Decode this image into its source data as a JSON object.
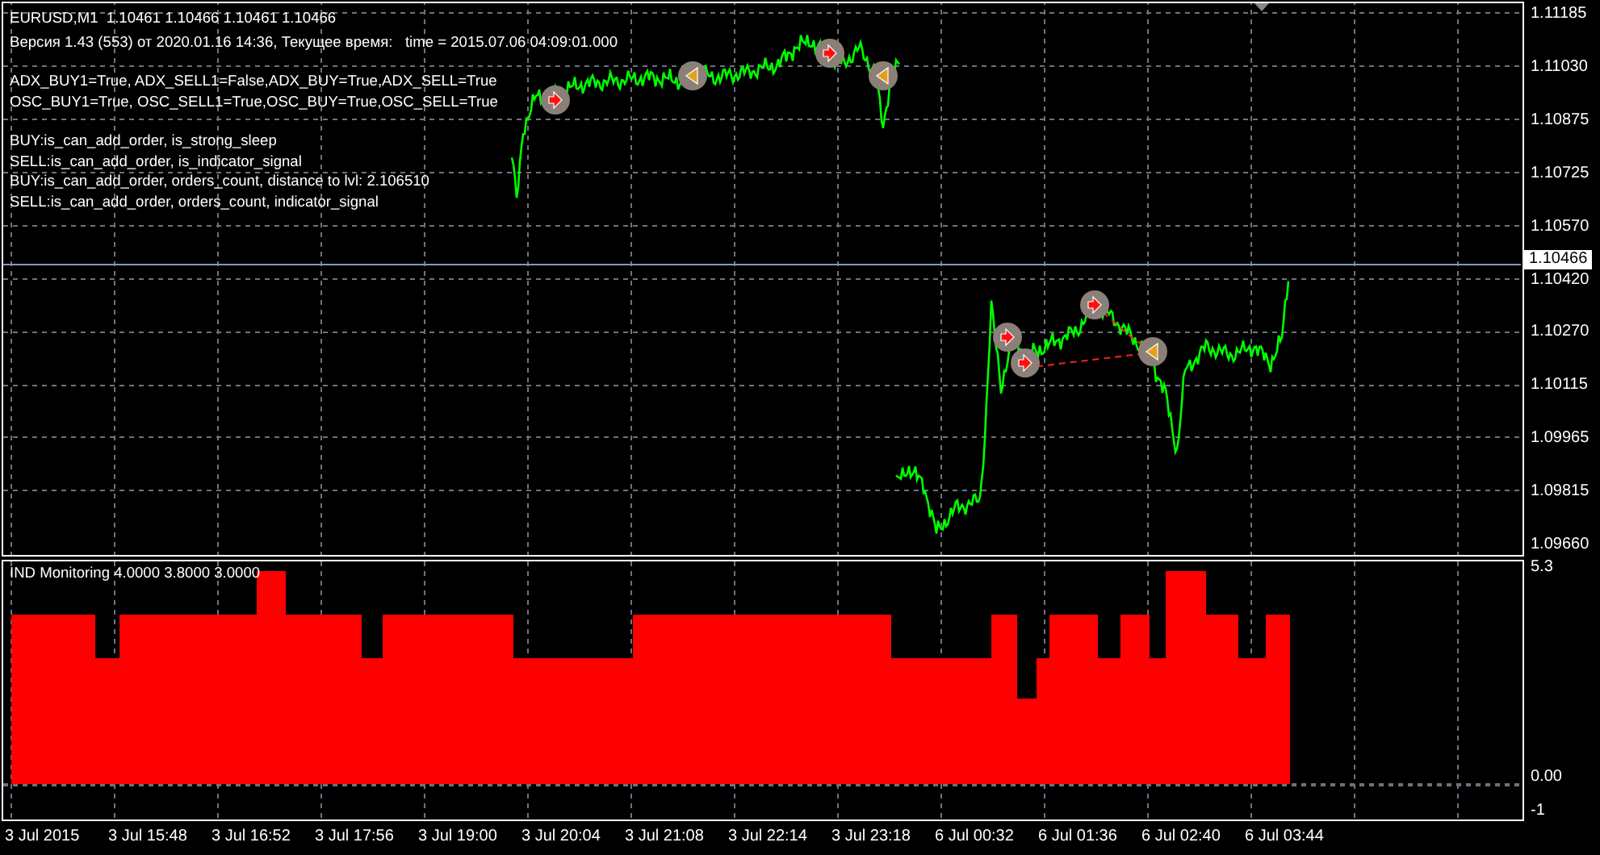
{
  "chart": {
    "header": "EURUSD,M1  1.10461 1.10466 1.10461 1.10466",
    "version": "Версия 1.43 (553) от 2020.01.16 14:36, Текущее время:   time = 2015.07.06 04:09:01.000",
    "flags": [
      "ADX_BUY1=True, ADX_SELL1=False,ADX_BUY=True,ADX_SELL=True",
      "OSC_BUY1=True, OSC_SELL1=True,OSC_BUY=True,OSC_SELL=True"
    ],
    "messages": [
      "BUY:is_can_add_order, is_strong_sleep",
      "SELL:is_can_add_order, is_indicator_signal",
      "BUY:is_can_add_order, orders_count, distance to lvl: 2.106510",
      "SELL:is_can_add_order, orders_count, indicator_signal"
    ],
    "price_axis": [
      "1.11185",
      "1.11030",
      "1.10875",
      "1.10725",
      "1.10570",
      "1.10420",
      "1.10270",
      "1.10115",
      "1.09965",
      "1.09815",
      "1.09660"
    ],
    "current_price": "1.10466"
  },
  "indicator": {
    "title": "IND Monitoring 4.0000 3.8000 3.0000",
    "axis": [
      "5.3",
      "0.00",
      "-1"
    ]
  },
  "time_axis": [
    "3 Jul 2015",
    "3 Jul 15:48",
    "3 Jul 16:52",
    "3 Jul 17:56",
    "3 Jul 19:00",
    "3 Jul 20:04",
    "3 Jul 21:08",
    "3 Jul 22:14",
    "3 Jul 23:18",
    "6 Jul 00:32",
    "6 Jul 01:36",
    "6 Jul 02:40",
    "6 Jul 03:44"
  ]
}
